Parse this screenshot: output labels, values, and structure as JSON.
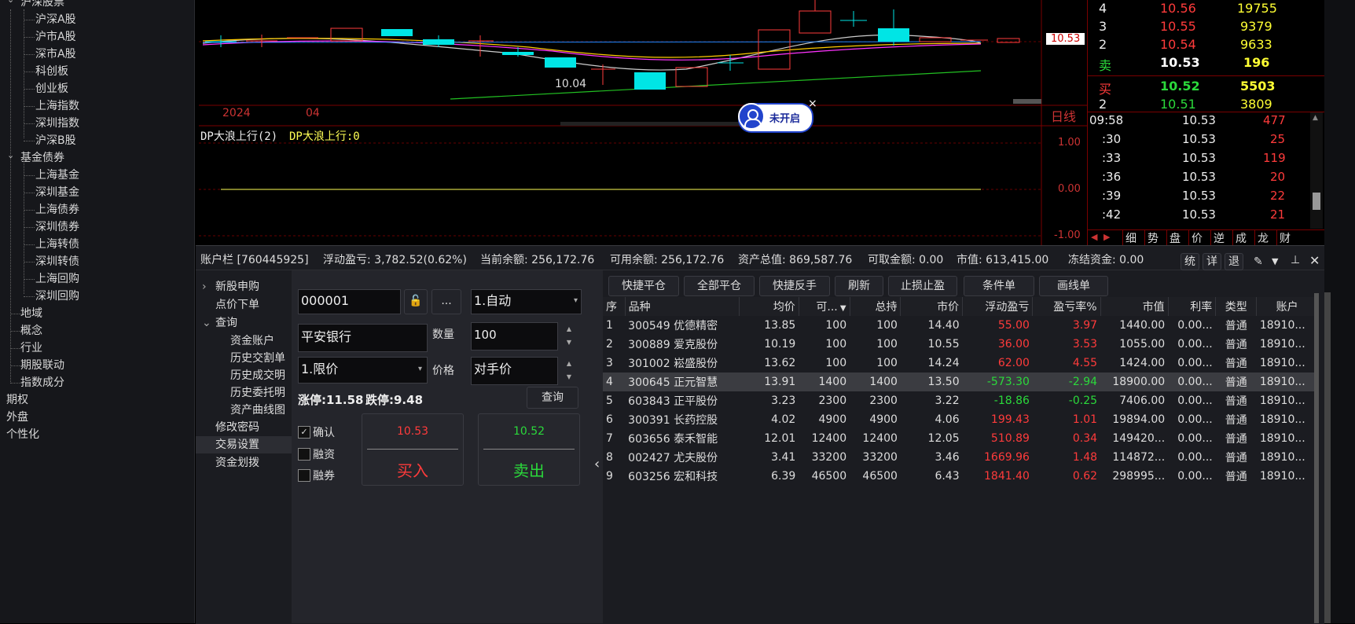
{
  "sidebar": {
    "items": [
      {
        "label": "沪深股票",
        "level": 0,
        "expanded": true
      },
      {
        "label": "沪深A股",
        "level": 1
      },
      {
        "label": "沪市A股",
        "level": 1
      },
      {
        "label": "深市A股",
        "level": 1
      },
      {
        "label": "科创板",
        "level": 1
      },
      {
        "label": "创业板",
        "level": 1
      },
      {
        "label": "上海指数",
        "level": 1
      },
      {
        "label": "深圳指数",
        "level": 1
      },
      {
        "label": "沪深B股",
        "level": 1
      },
      {
        "label": "基金债券",
        "level": 0,
        "expanded": true
      },
      {
        "label": "上海基金",
        "level": 1
      },
      {
        "label": "深圳基金",
        "level": 1
      },
      {
        "label": "上海债券",
        "level": 1
      },
      {
        "label": "深圳债券",
        "level": 1
      },
      {
        "label": "上海转债",
        "level": 1
      },
      {
        "label": "深圳转债",
        "level": 1
      },
      {
        "label": "上海回购",
        "level": 1
      },
      {
        "label": "深圳回购",
        "level": 1
      },
      {
        "label": "地域",
        "level": 0
      },
      {
        "label": "概念",
        "level": 0
      },
      {
        "label": "行业",
        "level": 0
      },
      {
        "label": "期股联动",
        "level": 0
      },
      {
        "label": "指数成分",
        "level": 0
      },
      {
        "label": "期权",
        "level": -1
      },
      {
        "label": "外盘",
        "level": -1
      },
      {
        "label": "个性化",
        "level": -1
      }
    ]
  },
  "chart": {
    "low_label": "10.04",
    "price_tag": "10.53",
    "axis_labels": [
      "2024",
      "04"
    ],
    "period": "日线",
    "indicator_name": "DP大浪上行(2)",
    "indicator_value": "DP大浪上行:0",
    "y_ticks": [
      "1.00",
      "0.00",
      "-1.00"
    ],
    "badge_text": "未开启",
    "badge_close": "×"
  },
  "quote": {
    "asks": [
      {
        "lvl": "4",
        "price": "10.56",
        "vol": "19755"
      },
      {
        "lvl": "3",
        "price": "10.55",
        "vol": "9379"
      },
      {
        "lvl": "2",
        "price": "10.54",
        "vol": "9633"
      },
      {
        "lvl": "卖",
        "price": "10.53",
        "vol": "196"
      }
    ],
    "bids": [
      {
        "lvl": "买",
        "price": "10.52",
        "vol": "5503"
      },
      {
        "lvl": "2",
        "price": "10.51",
        "vol": "3809"
      }
    ],
    "ticks": [
      {
        "t": "09:58",
        "p": "10.53",
        "v": "477"
      },
      {
        "t": ":30",
        "p": "10.53",
        "v": "25"
      },
      {
        "t": ":33",
        "p": "10.53",
        "v": "119"
      },
      {
        "t": ":36",
        "p": "10.53",
        "v": "20"
      },
      {
        "t": ":39",
        "p": "10.53",
        "v": "22"
      },
      {
        "t": ":42",
        "p": "10.53",
        "v": "21"
      }
    ],
    "tabs": [
      "细",
      "势",
      "盘",
      "价",
      "逆",
      "成",
      "龙",
      "财"
    ]
  },
  "account_bar": {
    "account": "账户栏 [760445925]",
    "float_pl": "浮动盈亏: 3,782.52(0.62%)",
    "balance": "当前余额: 256,172.76",
    "available": "可用余额: 256,172.76",
    "total_assets": "资产总值: 869,587.76",
    "withdrawable": "可取金额: 0.00",
    "market_value": "市值: 613,415.00",
    "frozen": "冻结资金: 0.00",
    "icons": [
      "统",
      "详",
      "退"
    ]
  },
  "nav": {
    "items": [
      {
        "label": "新股申购",
        "caret": "›"
      },
      {
        "label": "点价下单"
      },
      {
        "label": "查询",
        "caret": "⌄"
      },
      {
        "label": "资金账户",
        "sub": true
      },
      {
        "label": "历史交割单",
        "sub": true
      },
      {
        "label": "历史成交明",
        "sub": true
      },
      {
        "label": "历史委托明",
        "sub": true
      },
      {
        "label": "资产曲线图",
        "sub": true
      },
      {
        "label": "修改密码"
      },
      {
        "label": "交易设置"
      },
      {
        "label": "资金划拨"
      }
    ]
  },
  "order": {
    "code": "000001",
    "more": "...",
    "mode": "1.自动",
    "name": "平安银行",
    "qty_label": "数量",
    "qty": "100",
    "price_type": "1.限价",
    "price_label": "价格",
    "price": "对手价",
    "limit_up": "涨停:11.58",
    "limit_down": "跌停:9.48",
    "query": "查询",
    "confirm": "确认",
    "margin": "融资",
    "short": "融券",
    "buy_price": "10.53",
    "buy_label": "买入",
    "sell_price": "10.52",
    "sell_label": "卖出"
  },
  "toolbar": {
    "buttons": [
      "快捷平仓",
      "全部平仓",
      "快捷反手",
      "刷新",
      "止损止盈",
      "条件单",
      "画线单"
    ]
  },
  "positions": {
    "headers": [
      "序",
      "品种",
      "均价",
      "可...",
      "总持",
      "市价",
      "浮动盈亏",
      "盈亏率%",
      "市值",
      "利率",
      "类型",
      "账户"
    ],
    "rows": [
      {
        "i": "1",
        "name": "300549 优德精密",
        "avg": "13.85",
        "avail": "100",
        "total": "100",
        "px": "14.40",
        "pl": "55.00",
        "rate": "3.97",
        "mv": "1440.00",
        "ir": "0.00...",
        "type": "普通",
        "acct": "18910..."
      },
      {
        "i": "2",
        "name": "300889 爱克股份",
        "avg": "10.19",
        "avail": "100",
        "total": "100",
        "px": "10.55",
        "pl": "36.00",
        "rate": "3.53",
        "mv": "1055.00",
        "ir": "0.00...",
        "type": "普通",
        "acct": "18910..."
      },
      {
        "i": "3",
        "name": "301002 崧盛股份",
        "avg": "13.62",
        "avail": "100",
        "total": "100",
        "px": "14.24",
        "pl": "62.00",
        "rate": "4.55",
        "mv": "1424.00",
        "ir": "0.00...",
        "type": "普通",
        "acct": "18910..."
      },
      {
        "i": "4",
        "name": "300645 正元智慧",
        "avg": "13.91",
        "avail": "1400",
        "total": "1400",
        "px": "13.50",
        "pl": "-573.30",
        "rate": "-2.94",
        "mv": "18900.00",
        "ir": "0.00...",
        "type": "普通",
        "acct": "18910..."
      },
      {
        "i": "5",
        "name": "603843 正平股份",
        "avg": "3.23",
        "avail": "2300",
        "total": "2300",
        "px": "3.22",
        "pl": "-18.86",
        "rate": "-0.25",
        "mv": "7406.00",
        "ir": "0.00...",
        "type": "普通",
        "acct": "18910..."
      },
      {
        "i": "6",
        "name": "300391 长药控股",
        "avg": "4.02",
        "avail": "4900",
        "total": "4900",
        "px": "4.06",
        "pl": "199.43",
        "rate": "1.01",
        "mv": "19894.00",
        "ir": "0.00...",
        "type": "普通",
        "acct": "18910..."
      },
      {
        "i": "7",
        "name": "603656 泰禾智能",
        "avg": "12.01",
        "avail": "12400",
        "total": "12400",
        "px": "12.05",
        "pl": "510.89",
        "rate": "0.34",
        "mv": "149420...",
        "ir": "0.00...",
        "type": "普通",
        "acct": "18910..."
      },
      {
        "i": "8",
        "name": "002427 尤夫股份",
        "avg": "3.41",
        "avail": "33200",
        "total": "33200",
        "px": "3.46",
        "pl": "1669.96",
        "rate": "1.48",
        "mv": "114872...",
        "ir": "0.00...",
        "type": "普通",
        "acct": "18910..."
      },
      {
        "i": "9",
        "name": "603256 宏和科技",
        "avg": "6.39",
        "avail": "46500",
        "total": "46500",
        "px": "6.43",
        "pl": "1841.40",
        "rate": "0.62",
        "mv": "298995...",
        "ir": "0.00...",
        "type": "普通",
        "acct": "18910..."
      }
    ]
  }
}
